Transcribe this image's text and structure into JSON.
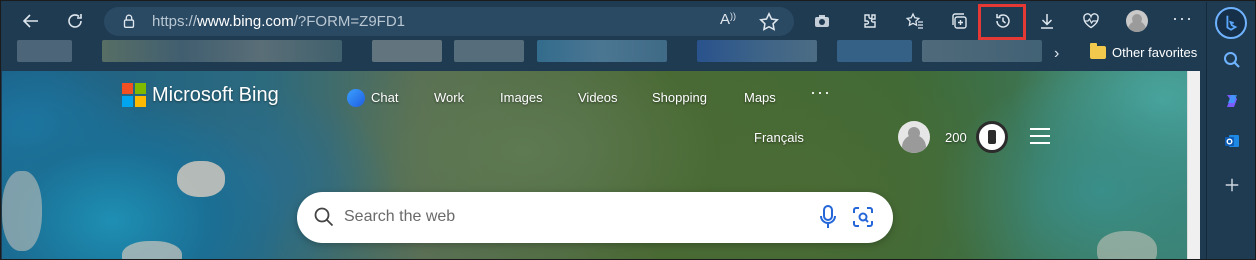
{
  "browser": {
    "url_prefix": "https://",
    "url_host": "www.bing.com",
    "url_rest": "/?FORM=Z9FD1",
    "read_aloud_label": "A",
    "more_label": "···"
  },
  "favorites_bar": {
    "overflow_label": "›",
    "other_favorites_label": "Other favorites"
  },
  "bing": {
    "brand": "Microsoft Bing",
    "nav": [
      {
        "label": "Chat"
      },
      {
        "label": "Work"
      },
      {
        "label": "Images"
      },
      {
        "label": "Videos"
      },
      {
        "label": "Shopping"
      },
      {
        "label": "Maps"
      }
    ],
    "nav_more": "···",
    "language_link": "Français",
    "rewards_points": "200",
    "search_placeholder": "Search the web"
  },
  "colors": {
    "browser_chrome": "#1f3b52",
    "highlight": "#e53935",
    "accent": "#2566d9"
  },
  "icons": {
    "toolbar": [
      "back-icon",
      "refresh-icon",
      "lock-icon",
      "read-aloud-icon",
      "favorite-star-icon",
      "camera-icon",
      "extensions-icon",
      "favorites-icon",
      "collections-icon",
      "history-icon",
      "downloads-icon",
      "health-icon",
      "profile-icon",
      "more-icon"
    ],
    "sidebar": [
      "bing-copilot-icon",
      "search-icon",
      "copilot-icon",
      "outlook-icon",
      "add-icon"
    ]
  }
}
